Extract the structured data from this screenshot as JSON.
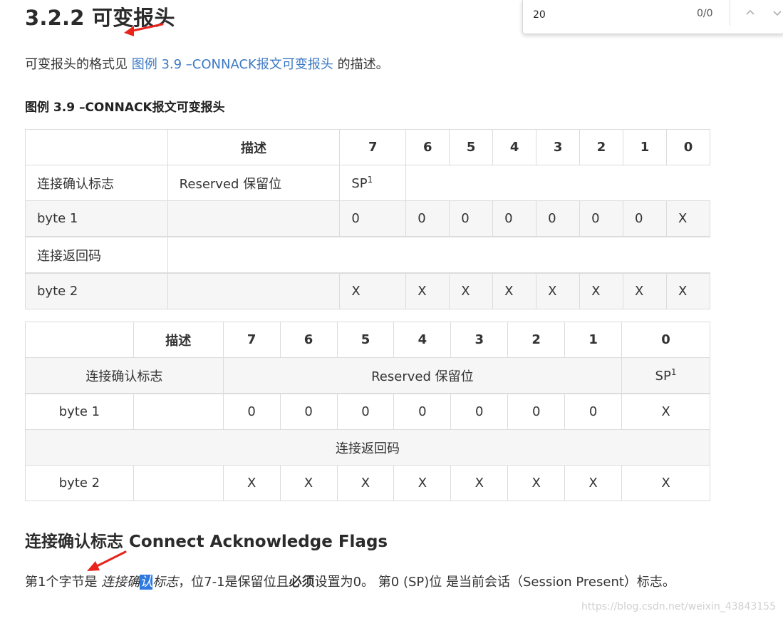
{
  "heading": "3.2.2 可变报头",
  "intro": {
    "prefix": "可变报头的格式见 ",
    "link": "图例 3.9 –CONNACK报文可变报头",
    "suffix": " 的描述。"
  },
  "caption": "图例 3.9 –CONNACK报文可变报头",
  "table1": {
    "headers": [
      "",
      "描述",
      "7",
      "6",
      "5",
      "4",
      "3",
      "2",
      "1",
      "0"
    ],
    "row_flags": {
      "label": "连接确认标志",
      "desc": "Reserved 保留位",
      "bit7": "SP",
      "sup": "1"
    },
    "row_byte1": {
      "label": "byte 1",
      "bits": [
        "0",
        "0",
        "0",
        "0",
        "0",
        "0",
        "0",
        "X"
      ]
    },
    "row_return": {
      "label": "连接返回码"
    },
    "row_byte2": {
      "label": "byte 2",
      "bits": [
        "X",
        "X",
        "X",
        "X",
        "X",
        "X",
        "X",
        "X"
      ]
    }
  },
  "table2": {
    "headers": [
      "",
      "描述",
      "7",
      "6",
      "5",
      "4",
      "3",
      "2",
      "1",
      "0"
    ],
    "row_flags": {
      "label": "连接确认标志",
      "desc": "Reserved 保留位",
      "sp": "SP",
      "sup": "1"
    },
    "row_byte1": {
      "label": "byte 1",
      "bits": [
        "0",
        "0",
        "0",
        "0",
        "0",
        "0",
        "0",
        "X"
      ]
    },
    "row_return": {
      "label": "连接返回码"
    },
    "row_byte2": {
      "label": "byte 2",
      "bits": [
        "X",
        "X",
        "X",
        "X",
        "X",
        "X",
        "X",
        "X"
      ]
    }
  },
  "subheading": "连接确认标志 Connect Acknowledge Flags",
  "body": {
    "p1": "第1个字节是 ",
    "em1": "连接确",
    "em_hl": "认",
    "em2": "标志",
    "p2": "，位7-1是保留位且",
    "strong": "必须",
    "p3": "设置为0。 第0 (SP)位 是当前会话（Session Present）标志。"
  },
  "watermark": "https://blog.csdn.net/weixin_43843155",
  "findbar": {
    "value": "20",
    "count": "0/0"
  },
  "colors": {
    "link": "#3b78c4",
    "highlight": "#2e7ae0",
    "arrow": "#e8231c"
  }
}
